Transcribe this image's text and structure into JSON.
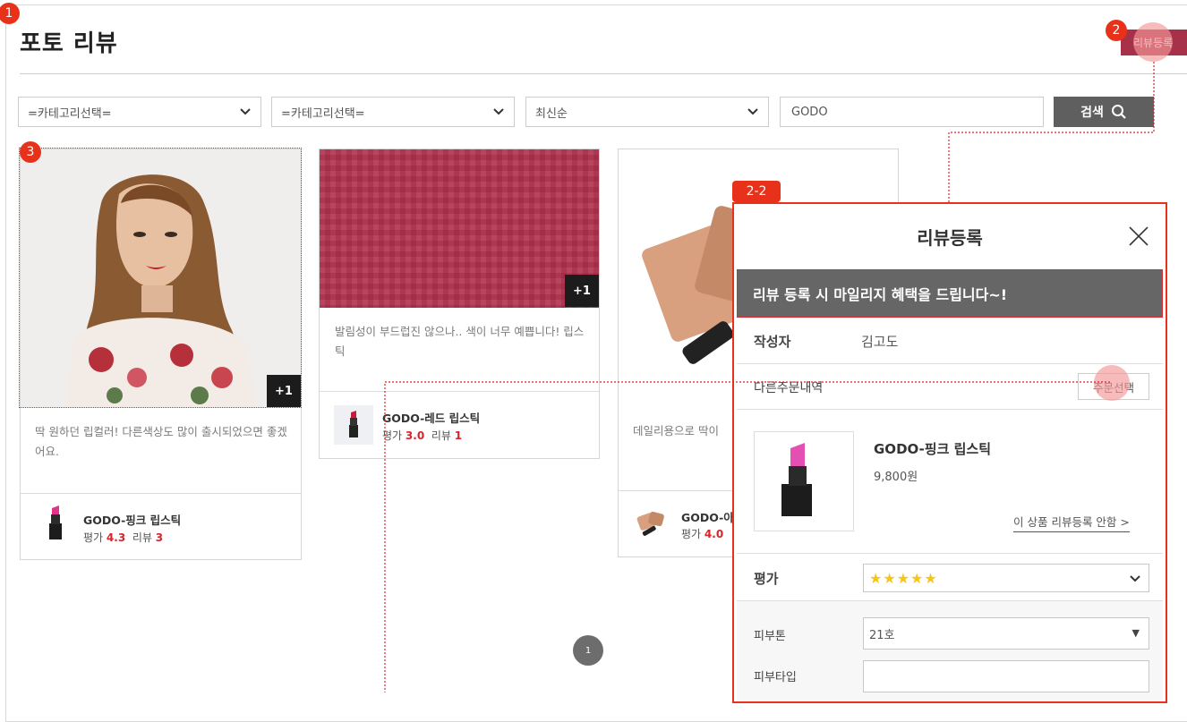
{
  "page": {
    "title": "포토 리뷰",
    "register_button": "리뷰등록"
  },
  "markers": {
    "m1": "1",
    "m2": "2",
    "m3": "3",
    "m22": "2-2"
  },
  "filters": {
    "category1": "=카테고리선택=",
    "category2": "=카테고리선택=",
    "sort": "최신순",
    "search_value": "GODO",
    "search_button": "검색"
  },
  "reviews": [
    {
      "text": "딱 원하던 립컬러! 다른색상도 많이 출시되었으면 좋겠어요.",
      "extra": "+1",
      "product": "GODO-핑크 립스틱",
      "rating_label": "평가",
      "rating": "4.3",
      "count_label": "리뷰",
      "count": "3"
    },
    {
      "text": "발림성이 부드럽진 않으나.. 색이 너무 예쁩니다! 립스틱",
      "extra": "+1",
      "product": "GODO-레드 립스틱",
      "rating_label": "평가",
      "rating": "3.0",
      "count_label": "리뷰",
      "count": "1"
    },
    {
      "text": "데일리용으로 딱이",
      "extra": "",
      "product": "GODO-아",
      "rating_label": "평가",
      "rating": "4.0",
      "count_label": "",
      "count": ""
    }
  ],
  "pagination": {
    "current": "1"
  },
  "modal": {
    "title": "리뷰등록",
    "banner": "리뷰 등록 시 마일리지 혜택을 드립니다~!",
    "author_label": "작성자",
    "author_value": "김고도",
    "order_label": "다른주문내역",
    "order_button": "주문선택",
    "product_name": "GODO-핑크 립스틱",
    "product_price": "9,800원",
    "no_review_link": "이 상품 리뷰등록 안함 >",
    "rating_label": "평가",
    "rating_stars": "★★★★★",
    "skin_tone_label": "피부톤",
    "skin_tone_value": "21호",
    "skin_type_label": "피부타입"
  },
  "colors": {
    "accent": "#e8311a",
    "brand": "#a8314a",
    "rating": "#d8242a",
    "star": "#f5c518"
  }
}
